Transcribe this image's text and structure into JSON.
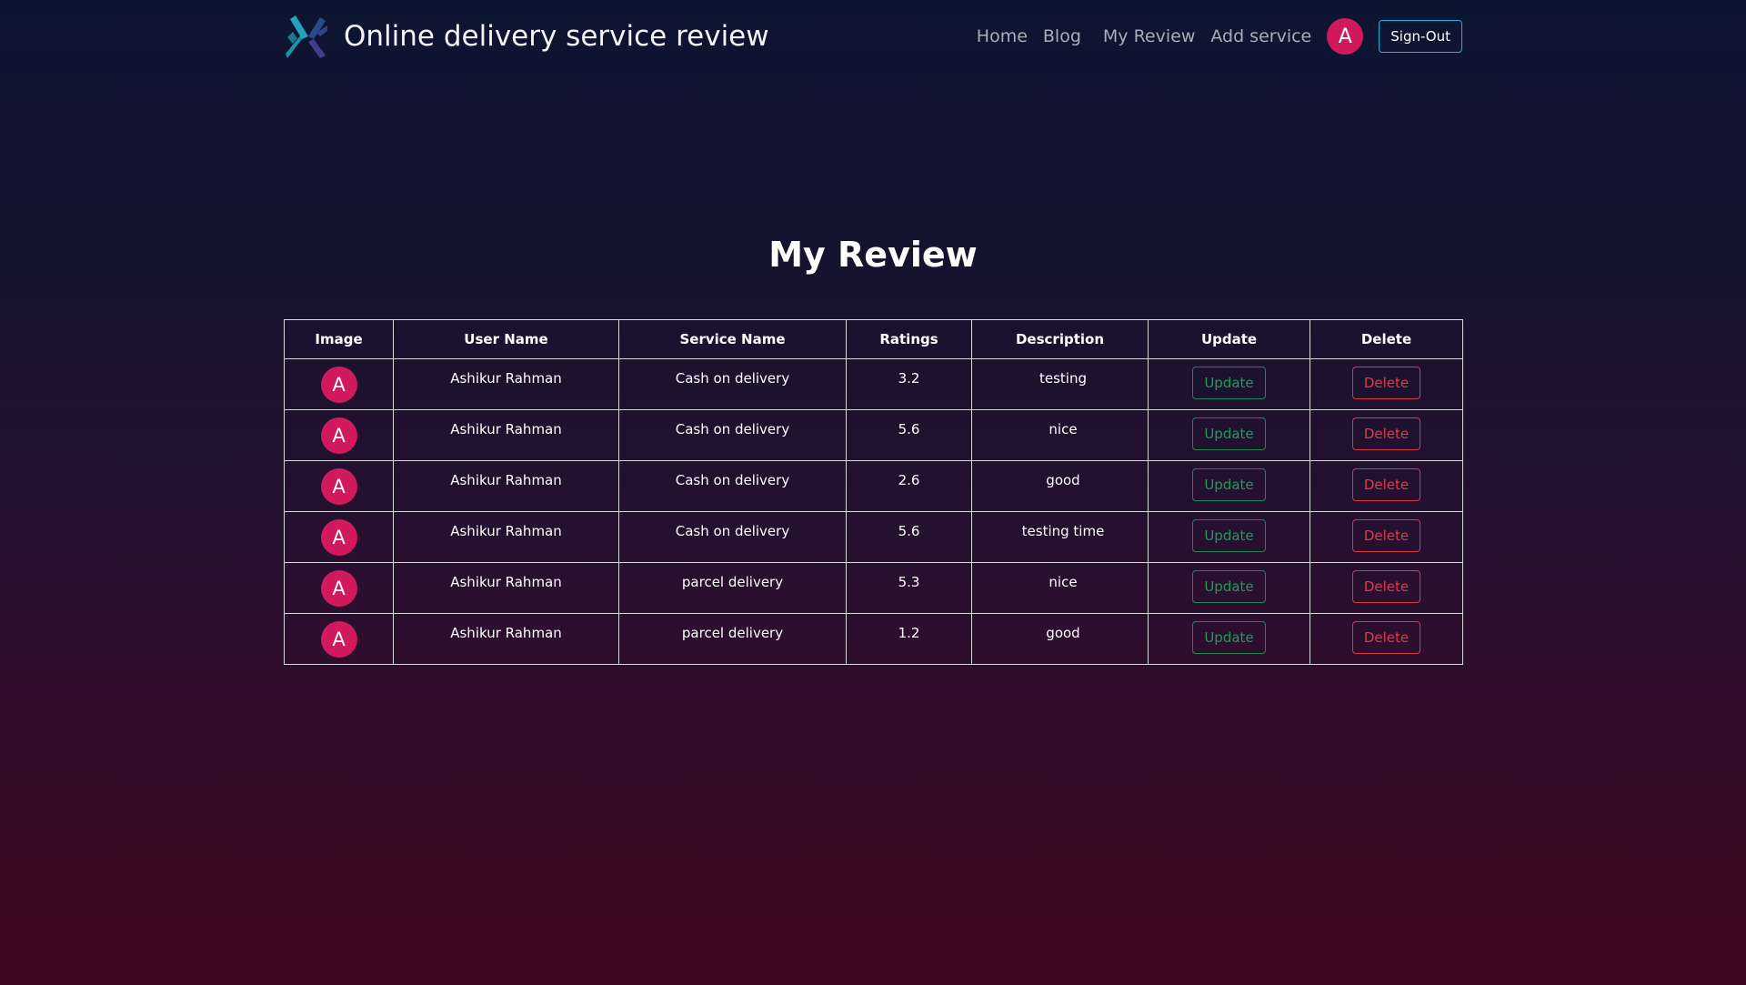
{
  "header": {
    "brand_title": "Online delivery service review",
    "nav": [
      "Home",
      "Blog",
      "My Review",
      "Add service"
    ],
    "avatar_letter": "A",
    "signout_label": "Sign-Out"
  },
  "main": {
    "title": "My Review",
    "columns": [
      "Image",
      "User Name",
      "Service Name",
      "Ratings",
      "Description",
      "Update",
      "Delete"
    ],
    "rows": [
      {
        "avatar": "A",
        "user": "Ashikur Rahman",
        "service": "Cash on delivery",
        "rating": "3.2",
        "description": "testing",
        "update": "Update",
        "delete": "Delete"
      },
      {
        "avatar": "A",
        "user": "Ashikur Rahman",
        "service": "Cash on delivery",
        "rating": "5.6",
        "description": "nice",
        "update": "Update",
        "delete": "Delete"
      },
      {
        "avatar": "A",
        "user": "Ashikur Rahman",
        "service": "Cash on delivery",
        "rating": "2.6",
        "description": "good",
        "update": "Update",
        "delete": "Delete"
      },
      {
        "avatar": "A",
        "user": "Ashikur Rahman",
        "service": "Cash on delivery",
        "rating": "5.6",
        "description": "testing time",
        "update": "Update",
        "delete": "Delete"
      },
      {
        "avatar": "A",
        "user": "Ashikur Rahman",
        "service": "parcel delivery",
        "rating": "5.3",
        "description": "nice",
        "update": "Update",
        "delete": "Delete"
      },
      {
        "avatar": "A",
        "user": "Ashikur Rahman",
        "service": "parcel delivery",
        "rating": "1.2",
        "description": "good",
        "update": "Update",
        "delete": "Delete"
      }
    ]
  },
  "colors": {
    "avatar": "#d11a5d",
    "update_accent": "#198754",
    "delete_accent": "#dc3545",
    "signout_border": "#19b4d8"
  },
  "icons": {
    "logo": "brand-logo-icon"
  }
}
